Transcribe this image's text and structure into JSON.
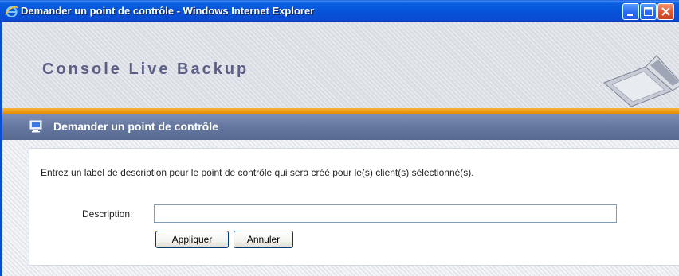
{
  "window": {
    "title": "Demander un point de contrôle - Windows Internet Explorer",
    "icon": "internet-explorer-icon",
    "controls": [
      "minimize-icon",
      "maximize-icon",
      "close-icon"
    ]
  },
  "banner": {
    "title": "Console Live Backup",
    "illustration": "laptop-icon"
  },
  "section": {
    "icon": "monitor-icon",
    "title": "Demander un point de contrôle"
  },
  "form": {
    "instruction": "Entrez un label de description pour le point de contrôle qui sera créé pour le(s) client(s) sélectionné(s).",
    "description_label": "Description:",
    "description_value": "",
    "apply_label": "Appliquer",
    "cancel_label": "Annuler"
  },
  "colors": {
    "titlebar": "#0553d8",
    "accent_orange": "#f19a13",
    "section_header": "#65779f",
    "banner_text": "#5b5f86"
  }
}
